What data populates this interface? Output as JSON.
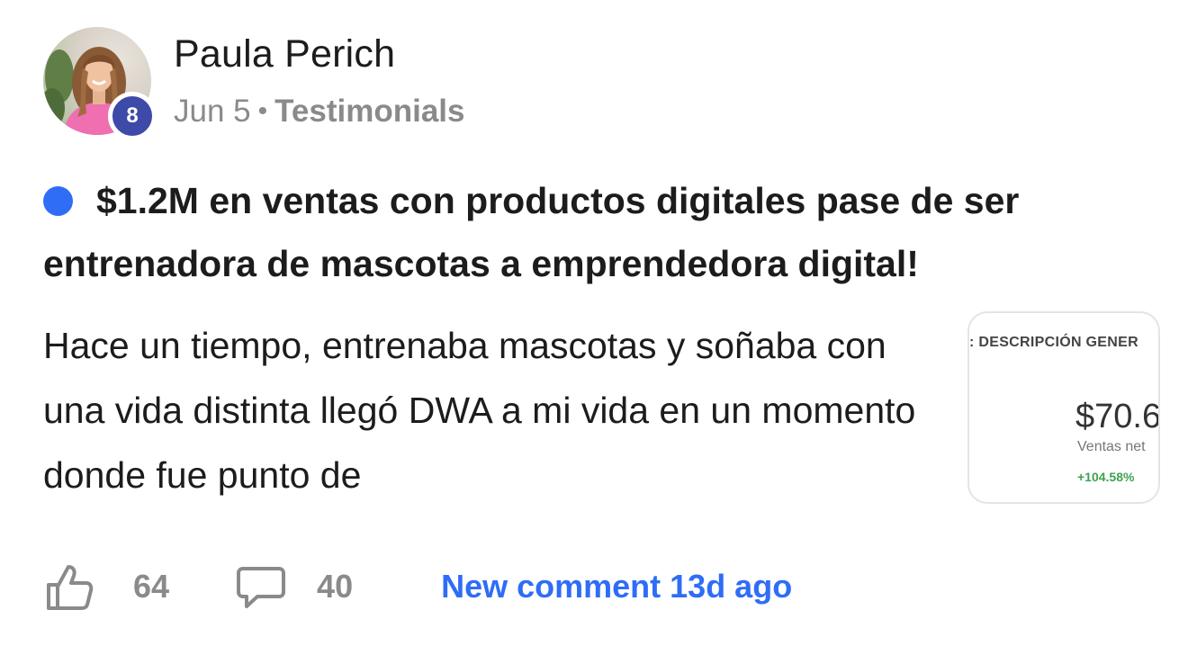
{
  "author": {
    "name": "Paula Perich",
    "level": "8"
  },
  "meta": {
    "date": "Jun 5",
    "separator": "•",
    "category": "Testimonials"
  },
  "post": {
    "title": "$1.2M en ventas con productos digitales pase de ser entrenadora de mascotas a emprendedora digital!",
    "body": "Hace un tiempo, entrenaba mascotas y soñaba con una vida distinta llegó DWA a mi vida en un momento donde fue punto de",
    "status_color": "#2f6df6"
  },
  "thumbnail": {
    "header": ": DESCRIPCIÓN GENER",
    "value": "$70.6",
    "label": "Ventas net",
    "change": "+104.58%"
  },
  "actions": {
    "likes": "64",
    "comments": "40",
    "new_comment": "New comment 13d ago"
  },
  "colors": {
    "accent": "#2f6df6",
    "badge": "#3e4aa8",
    "muted": "#8a8a8a",
    "positive": "#3fa34d"
  },
  "icons": {
    "like": "thumbs-up-icon",
    "comment": "speech-bubble-icon"
  }
}
